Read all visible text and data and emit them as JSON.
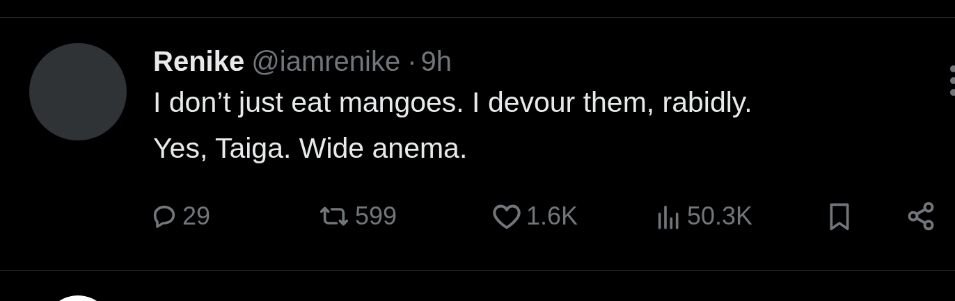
{
  "tweet": {
    "name": "Renike",
    "handle": "@iamrenike",
    "separator": "·",
    "time": "9h",
    "text_lines": [
      "I don’t just eat mangoes. I devour them, rabidly.",
      "Yes, Taiga. Wide anema."
    ],
    "actions": [
      {
        "kind": "reply",
        "count": "29"
      },
      {
        "kind": "repost",
        "count": "599"
      },
      {
        "kind": "like",
        "count": "1.6K"
      },
      {
        "kind": "views",
        "count": "50.3K"
      },
      {
        "kind": "bookmark"
      },
      {
        "kind": "share"
      }
    ]
  }
}
